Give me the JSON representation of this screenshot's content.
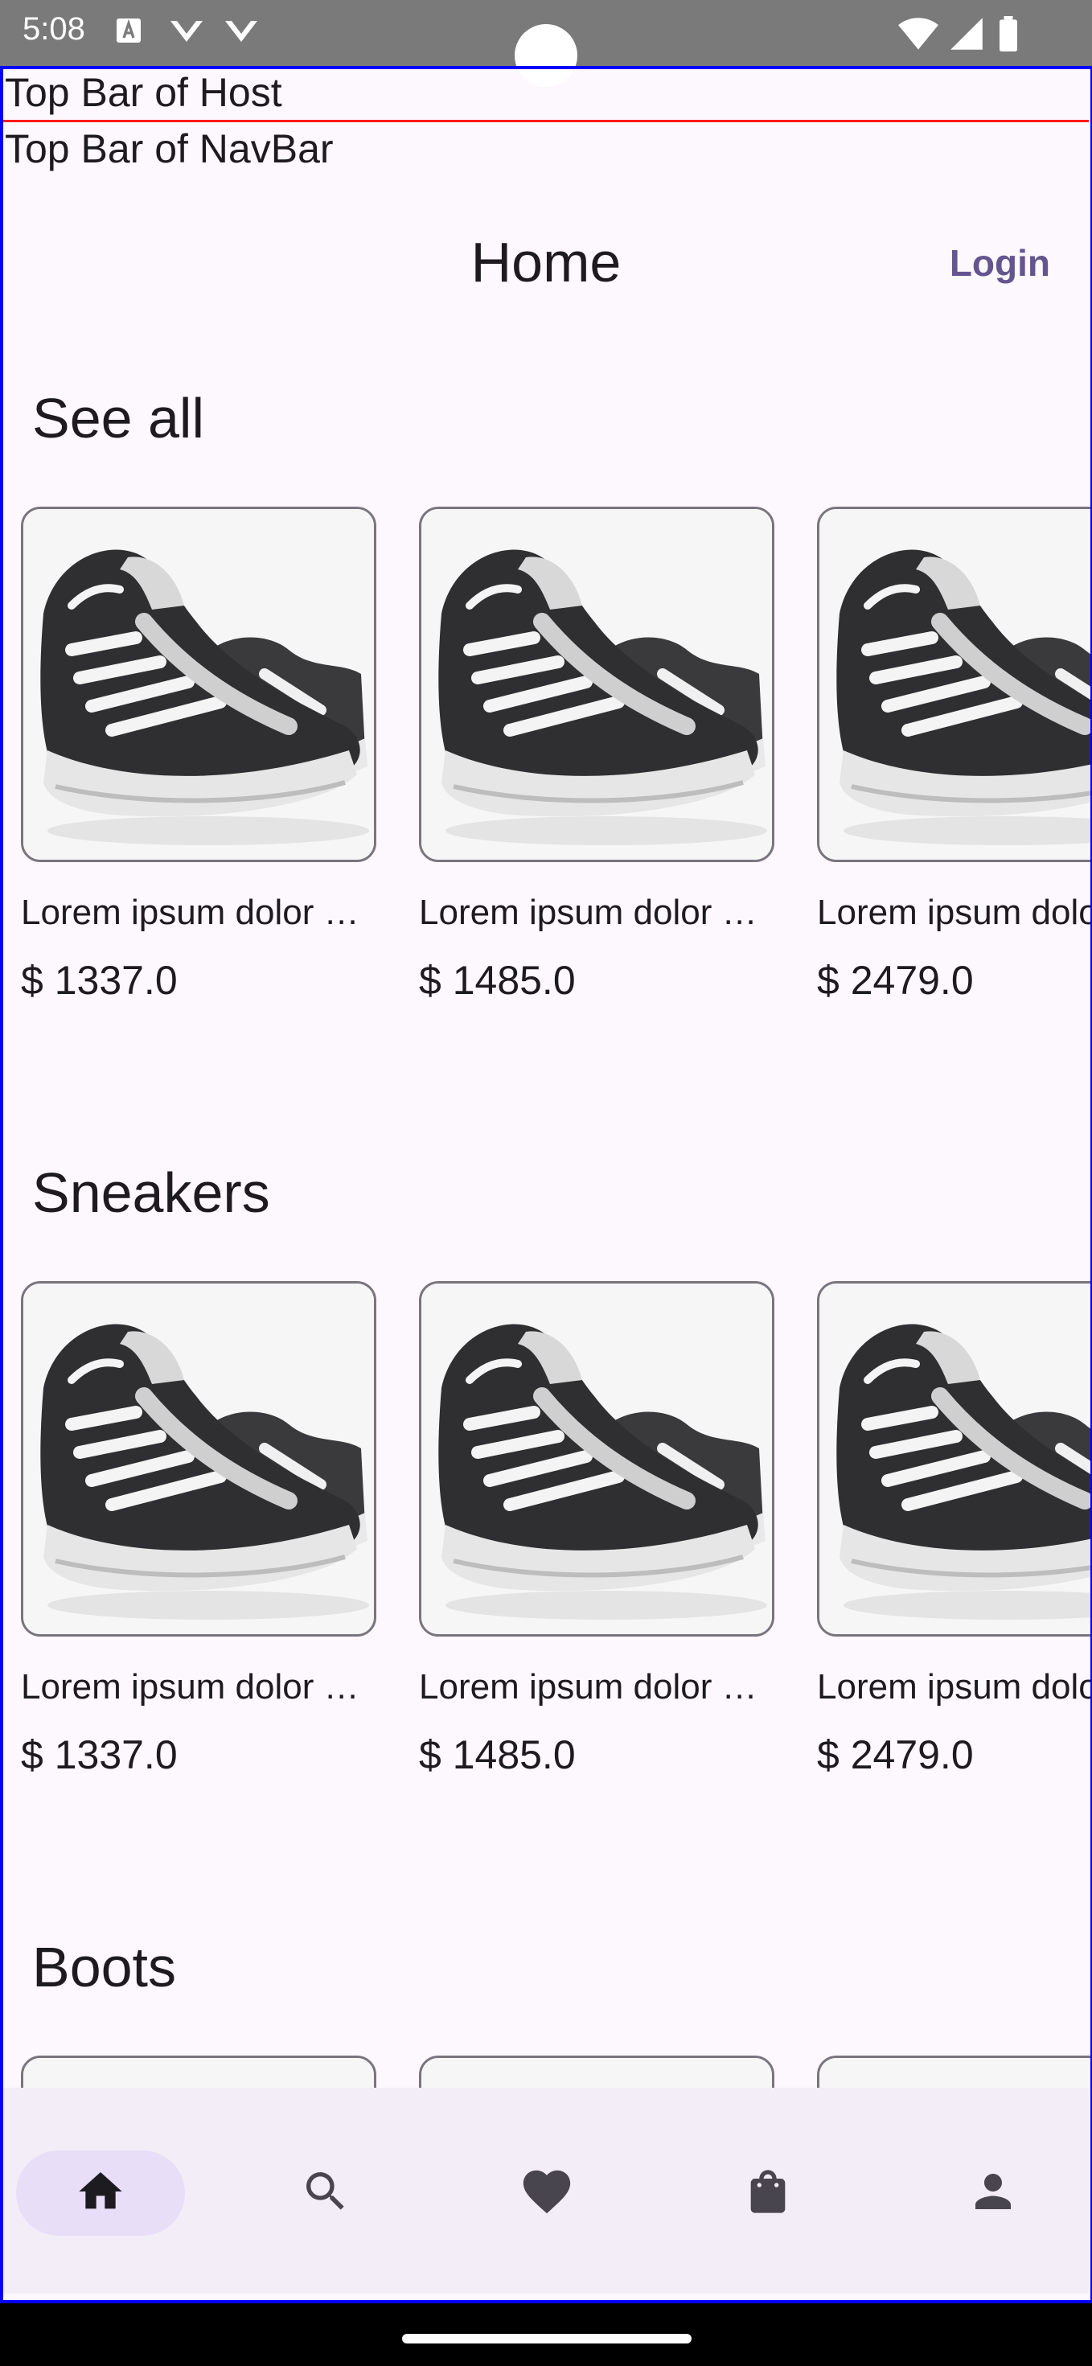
{
  "status_bar": {
    "time": "5:08",
    "icons": [
      "text-a-icon",
      "chevron-down-icon",
      "chevron-down-icon",
      "wifi-icon",
      "signal-icon",
      "battery-icon"
    ]
  },
  "debug": {
    "host_label": "Top Bar of Host",
    "nav_label": "Top Bar of NavBar",
    "frame_color": "#0000ff",
    "rule_color": "#ff1a1a"
  },
  "app_bar": {
    "title": "Home",
    "login_label": "Login",
    "accent": "#65558f"
  },
  "sections": [
    {
      "title": "See all",
      "products": [
        {
          "name": "Lorem ipsum dolor sit amet",
          "price": "$ 1337.0"
        },
        {
          "name": "Lorem ipsum dolor sit amet",
          "price": "$ 1485.0"
        },
        {
          "name": "Lorem ipsum dolor sit amet",
          "price": "$ 2479.0"
        }
      ]
    },
    {
      "title": "Sneakers",
      "products": [
        {
          "name": "Lorem ipsum dolor sit amet",
          "price": "$ 1337.0"
        },
        {
          "name": "Lorem ipsum dolor sit amet",
          "price": "$ 1485.0"
        },
        {
          "name": "Lorem ipsum dolor sit amet",
          "price": "$ 2479.0"
        }
      ]
    },
    {
      "title": "Boots",
      "products": []
    }
  ],
  "bottom_nav": {
    "items": [
      {
        "icon": "home-icon",
        "active": true
      },
      {
        "icon": "search-icon",
        "active": false
      },
      {
        "icon": "heart-icon",
        "active": false
      },
      {
        "icon": "shopping-bag-icon",
        "active": false
      },
      {
        "icon": "person-icon",
        "active": false
      }
    ],
    "active_indicator_color": "#e8def8",
    "background": "#f3edf7"
  }
}
